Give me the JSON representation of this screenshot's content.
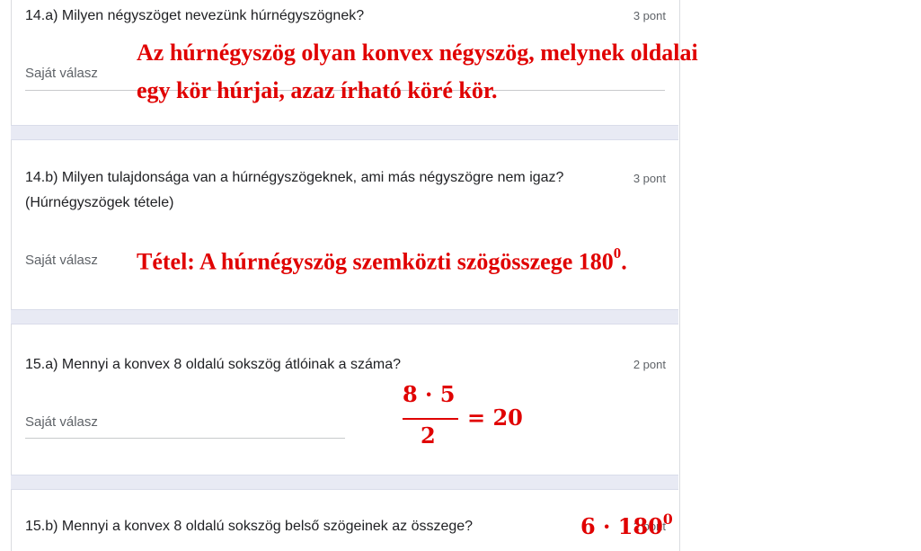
{
  "questions": [
    {
      "id": "14a",
      "text": "14.a) Milyen négyszöget nevezünk húrnégyszögnek?",
      "points": "3 pont",
      "answer_placeholder": "Saját válasz"
    },
    {
      "id": "14b",
      "text": "14.b) Milyen tulajdonsága van a húrnégyszögeknek, ami más négyszögre nem igaz? (Húrnégyszögek tétele)",
      "points": "3 pont",
      "answer_placeholder": "Saját válasz"
    },
    {
      "id": "15a",
      "text": "15.a) Mennyi a konvex 8 oldalú sokszög átlóinak a száma?",
      "points": "2 pont",
      "answer_placeholder": "Saját válasz"
    },
    {
      "id": "15b",
      "text": "15.b) Mennyi a konvex 8 oldalú sokszög belső szögeinek az összege?",
      "points": "2 pont"
    }
  ],
  "annotations": {
    "a14a_line1": "Az húrnégyszög olyan konvex négyszög, melynek oldalai",
    "a14a_line2": "egy kör húrjai, azaz írható köré kör.",
    "a14b_main": "Tétel: A húrnégyszög szemközti szögösszege 180",
    "a14b_sup": "0",
    "a14b_end": ".",
    "a15a_numerator": "8 · 5",
    "a15a_denominator": "2",
    "a15a_result": "= 20",
    "a15b_main": "6 · 180",
    "a15b_sup": "0"
  },
  "colors": {
    "annotation": "#e00000",
    "separator": "#e8eaf4",
    "placeholder": "#5f6368"
  }
}
